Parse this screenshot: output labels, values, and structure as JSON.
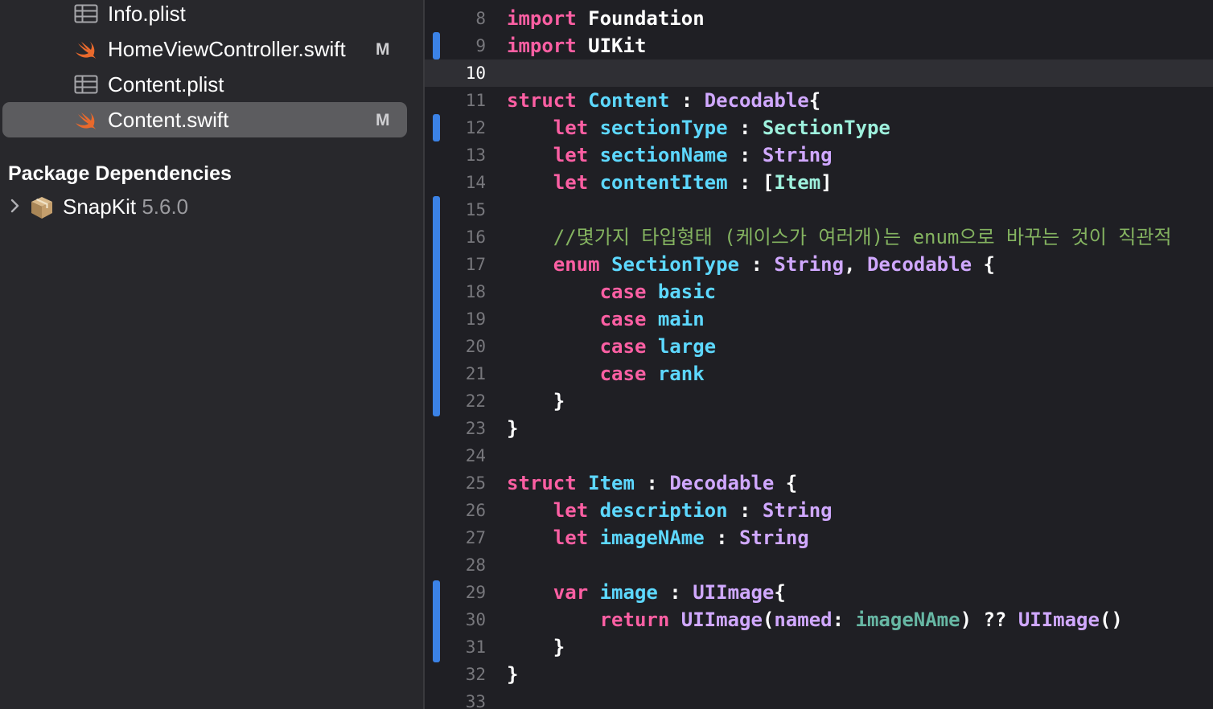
{
  "sidebar": {
    "files": [
      {
        "name": "Info.plist",
        "icon": "plist-table-icon",
        "badge": ""
      },
      {
        "name": "HomeViewController.swift",
        "icon": "swift-file-icon",
        "badge": "M"
      },
      {
        "name": "Content.plist",
        "icon": "plist-table-icon",
        "badge": ""
      },
      {
        "name": "Content.swift",
        "icon": "swift-file-icon",
        "badge": "M",
        "selected": true
      }
    ],
    "section_title": "Package Dependencies",
    "package": {
      "name": "SnapKit",
      "version": "5.6.0",
      "icon": "package-box-icon"
    }
  },
  "editor": {
    "current_line": 10,
    "colors": {
      "keyword": "#fc5fa3",
      "declaration": "#5dd8ff",
      "type": "#d0a8ff",
      "project": "#9ef1dd",
      "comment": "#84b360",
      "change_bar": "#3b82e6"
    },
    "lines": [
      {
        "n": "8",
        "tokens": [
          [
            "import",
            "kw"
          ],
          [
            " Foundation",
            "plain"
          ]
        ]
      },
      {
        "n": "9",
        "tokens": [
          [
            "import",
            "kw"
          ],
          [
            " UIKit",
            "plain"
          ]
        ]
      },
      {
        "n": "10",
        "tokens": []
      },
      {
        "n": "11",
        "tokens": [
          [
            "struct",
            "kw"
          ],
          [
            " ",
            "plain"
          ],
          [
            "Content",
            "decl"
          ],
          [
            " : ",
            "plain"
          ],
          [
            "Decodable",
            "type"
          ],
          [
            "{",
            "plain"
          ]
        ]
      },
      {
        "n": "12",
        "tokens": [
          [
            "    ",
            "plain"
          ],
          [
            "let",
            "kw"
          ],
          [
            " ",
            "plain"
          ],
          [
            "sectionType",
            "decl"
          ],
          [
            " : ",
            "plain"
          ],
          [
            "SectionType",
            "proj"
          ]
        ]
      },
      {
        "n": "13",
        "tokens": [
          [
            "    ",
            "plain"
          ],
          [
            "let",
            "kw"
          ],
          [
            " ",
            "plain"
          ],
          [
            "sectionName",
            "decl"
          ],
          [
            " : ",
            "plain"
          ],
          [
            "String",
            "type"
          ]
        ]
      },
      {
        "n": "14",
        "tokens": [
          [
            "    ",
            "plain"
          ],
          [
            "let",
            "kw"
          ],
          [
            " ",
            "plain"
          ],
          [
            "contentItem",
            "decl"
          ],
          [
            " : [",
            "plain"
          ],
          [
            "Item",
            "proj"
          ],
          [
            "]",
            "plain"
          ]
        ]
      },
      {
        "n": "15",
        "tokens": []
      },
      {
        "n": "16",
        "tokens": [
          [
            "    ",
            "plain"
          ],
          [
            "//몇가지 타입형태 (케이스가 여러개)는 enum으로 바꾸는 것이 직관적",
            "comment"
          ]
        ]
      },
      {
        "n": "17",
        "tokens": [
          [
            "    ",
            "plain"
          ],
          [
            "enum",
            "kw"
          ],
          [
            " ",
            "plain"
          ],
          [
            "SectionType",
            "decl"
          ],
          [
            " : ",
            "plain"
          ],
          [
            "String",
            "type"
          ],
          [
            ", ",
            "plain"
          ],
          [
            "Decodable",
            "type"
          ],
          [
            " {",
            "plain"
          ]
        ]
      },
      {
        "n": "18",
        "tokens": [
          [
            "        ",
            "plain"
          ],
          [
            "case",
            "kw"
          ],
          [
            " ",
            "plain"
          ],
          [
            "basic",
            "decl"
          ]
        ]
      },
      {
        "n": "19",
        "tokens": [
          [
            "        ",
            "plain"
          ],
          [
            "case",
            "kw"
          ],
          [
            " ",
            "plain"
          ],
          [
            "main",
            "decl"
          ]
        ]
      },
      {
        "n": "20",
        "tokens": [
          [
            "        ",
            "plain"
          ],
          [
            "case",
            "kw"
          ],
          [
            " ",
            "plain"
          ],
          [
            "large",
            "decl"
          ]
        ]
      },
      {
        "n": "21",
        "tokens": [
          [
            "        ",
            "plain"
          ],
          [
            "case",
            "kw"
          ],
          [
            " ",
            "plain"
          ],
          [
            "rank",
            "decl"
          ]
        ]
      },
      {
        "n": "22",
        "tokens": [
          [
            "    }",
            "plain"
          ]
        ]
      },
      {
        "n": "23",
        "tokens": [
          [
            "}",
            "plain"
          ]
        ]
      },
      {
        "n": "24",
        "tokens": []
      },
      {
        "n": "25",
        "tokens": [
          [
            "struct",
            "kw"
          ],
          [
            " ",
            "plain"
          ],
          [
            "Item",
            "decl"
          ],
          [
            " : ",
            "plain"
          ],
          [
            "Decodable",
            "type"
          ],
          [
            " {",
            "plain"
          ]
        ]
      },
      {
        "n": "26",
        "tokens": [
          [
            "    ",
            "plain"
          ],
          [
            "let",
            "kw"
          ],
          [
            " ",
            "plain"
          ],
          [
            "description",
            "decl"
          ],
          [
            " : ",
            "plain"
          ],
          [
            "String",
            "type"
          ]
        ]
      },
      {
        "n": "27",
        "tokens": [
          [
            "    ",
            "plain"
          ],
          [
            "let",
            "kw"
          ],
          [
            " ",
            "plain"
          ],
          [
            "imageNAme",
            "decl"
          ],
          [
            " : ",
            "plain"
          ],
          [
            "String",
            "type"
          ]
        ]
      },
      {
        "n": "28",
        "tokens": []
      },
      {
        "n": "29",
        "tokens": [
          [
            "    ",
            "plain"
          ],
          [
            "var",
            "kw"
          ],
          [
            " ",
            "plain"
          ],
          [
            "image",
            "decl"
          ],
          [
            " : ",
            "plain"
          ],
          [
            "UIImage",
            "type"
          ],
          [
            "{",
            "plain"
          ]
        ]
      },
      {
        "n": "30",
        "tokens": [
          [
            "        ",
            "plain"
          ],
          [
            "return",
            "kw"
          ],
          [
            " ",
            "plain"
          ],
          [
            "UIImage",
            "type"
          ],
          [
            "(",
            "plain"
          ],
          [
            "named",
            "type"
          ],
          [
            ": ",
            "plain"
          ],
          [
            "imageNAme",
            "proj2"
          ],
          [
            ") ?? ",
            "plain"
          ],
          [
            "UIImage",
            "type"
          ],
          [
            "()",
            "plain"
          ]
        ]
      },
      {
        "n": "31",
        "tokens": [
          [
            "    }",
            "plain"
          ]
        ]
      },
      {
        "n": "32",
        "tokens": [
          [
            "}",
            "plain"
          ]
        ]
      },
      {
        "n": "33",
        "tokens": []
      }
    ]
  }
}
